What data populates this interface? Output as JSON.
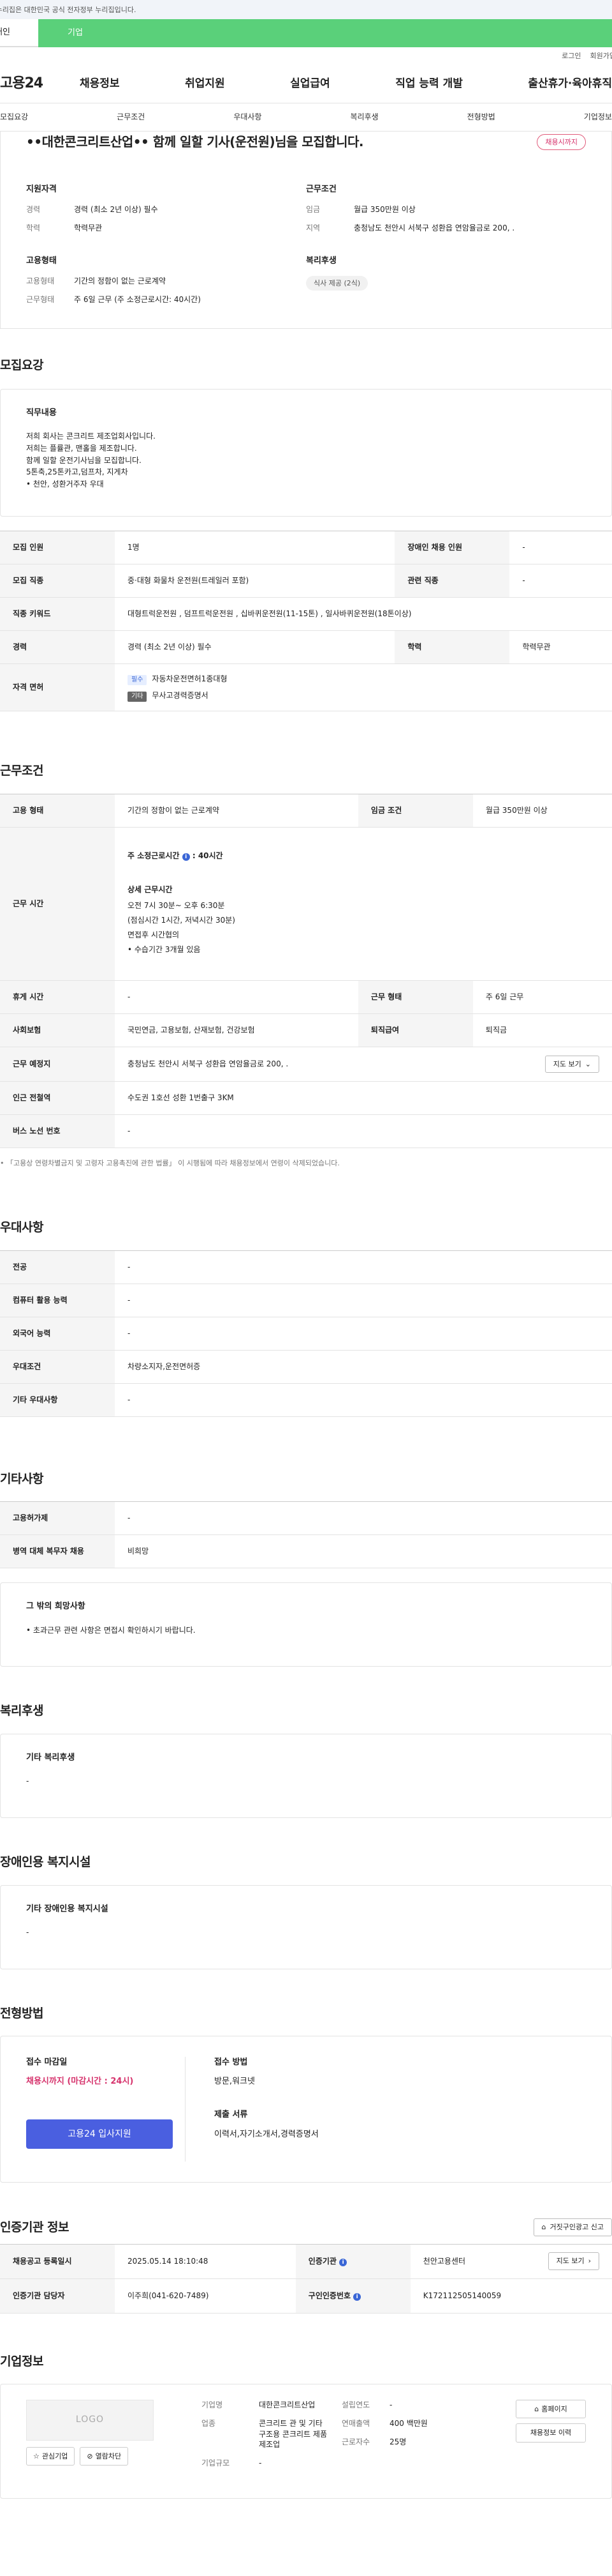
{
  "gov_banner": "이 누리집은 대한민국 공식 전자정부 누리집입니다.",
  "site_tabs": {
    "personal": "개인",
    "company": "기업"
  },
  "util": {
    "login": "로그인",
    "join": "회원가입"
  },
  "gnb": {
    "logo": "고용24",
    "menu": [
      "채용정보",
      "취업지원",
      "실업급여",
      "직업 능력 개발",
      "출산휴가·육아휴직"
    ]
  },
  "subnav": [
    "모집요강",
    "근무조건",
    "우대사항",
    "복리후생",
    "전형방법",
    "기업정보"
  ],
  "summary": {
    "title": "••대한콘크리트산업•• 함께 일할 기사(운전원)님을 모집합니다.",
    "deadline_badge": "채용시까지",
    "qualification": {
      "heading": "지원자격",
      "rows": [
        {
          "k": "경력",
          "v": "경력 (최소 2년 이상) 필수"
        },
        {
          "k": "학력",
          "v": "학력무관"
        }
      ]
    },
    "conditions": {
      "heading": "근무조건",
      "rows": [
        {
          "k": "임금",
          "v": "월급 350만원 이상"
        },
        {
          "k": "지역",
          "v": "충청남도 천안시 서북구 성환읍 연암율금로 200, ."
        }
      ]
    },
    "employment": {
      "heading": "고용형태",
      "rows": [
        {
          "k": "고용형태",
          "v": "기간의 정함이 없는 근로계약"
        },
        {
          "k": "근무형태",
          "v": "주 6일 근무 (주 소정근로시간: 40시간)"
        }
      ]
    },
    "welfare": {
      "heading": "복리후생",
      "pill": "식사 제공 (2식)"
    }
  },
  "recruit": {
    "title": "모집요강",
    "duty_heading": "직무내용",
    "duty_text": "저희 회사는 콘크리트 제조업회사입니다.\n저희는 플률관, 맨홀을 제조합니다.\n함께 일할 운전기사님을 모집합니다.\n5톤축,25톤카고,덤프차, 지게차\n• 천안, 성환거주자 우대",
    "labels": {
      "count": "모집 인원",
      "disabled": "장애인 채용 인원",
      "job": "모집 직종",
      "related": "관련 직종",
      "keywords": "직종 키워드",
      "career": "경력",
      "edu": "학력",
      "license": "자격 면허"
    },
    "count": "1명",
    "disabled": "-",
    "job": "중·대형 화물차 운전원(트레일러 포함)",
    "related": "-",
    "keywords": "대형트럭운전원 , 덤프트럭운전원 , 십바퀴운전원(11-15톤) , 일사바퀴운전원(18톤이상)",
    "career": "경력 (최소 2년 이상) 필수",
    "edu": "학력무관",
    "licenses": [
      {
        "tag": "필수",
        "name": "자동차운전면허1종대형"
      },
      {
        "tag": "기타",
        "name": "무사고경력증명서"
      }
    ]
  },
  "work": {
    "title": "근무조건",
    "labels": {
      "emp_type": "고용 형태",
      "wage": "임금 조건",
      "hours": "근무 시간",
      "holiday": "휴게 시간",
      "work_form": "근무 형태",
      "insurance": "사회보험",
      "retire": "퇴직급여",
      "place": "근무 예정지",
      "subway": "인근 전철역",
      "bus": "버스 노선 번호"
    },
    "emp_type": "기간의 정함이 없는 근로계약",
    "wage": "월급 350만원 이상",
    "hours_title": "주 소정근로시간",
    "hours_value": ": 40시간",
    "hours_detail_title": "상세 근무시간",
    "hours_detail": "오전 7시 30분~ 오후 6:30분\n(점심시간 1시간, 저녁시간 30분)\n면접후 시간협의\n• 수습기간 3개월 있음",
    "holiday": "-",
    "work_form": "주 6일 근무",
    "insurance": "국민연금, 고용보험, 산재보험, 건강보험",
    "retire": "퇴직금",
    "place": "충청남도 천안시 서북구 성환읍 연암율금로 200, .",
    "map_btn": "지도 보기",
    "subway": "수도권 1호선 성환 1번출구 3KM",
    "bus": "-",
    "note": "• 「고용상 연령차별금지 및 고령자 고용촉진에 관한 법률」 이 시행됨에 따라 채용정보에서 연령이 삭제되었습니다."
  },
  "prefer": {
    "title": "우대사항",
    "rows": [
      {
        "k": "전공",
        "v": "-"
      },
      {
        "k": "컴퓨터 활용 능력",
        "v": "-"
      },
      {
        "k": "외국어 능력",
        "v": "-"
      },
      {
        "k": "우대조건",
        "v": "차량소지자,운전면허증"
      },
      {
        "k": "기타 우대사항",
        "v": "-"
      }
    ]
  },
  "other": {
    "title": "기타사항",
    "rows": [
      {
        "k": "고용허가제",
        "v": "-"
      },
      {
        "k": "병역 대체 복무자 채용",
        "v": "비희망"
      }
    ],
    "hope_heading": "그 밖의 희망사항",
    "hope_text": "• 초과근무 관련 사항은 면접시 확인하시기 바랍니다."
  },
  "benefits": {
    "title": "복리후생",
    "heading": "기타 복리후생",
    "text": "-"
  },
  "facility": {
    "title": "장애인용 복지시설",
    "heading": "기타 장애인용 복지시설",
    "text": "-"
  },
  "process": {
    "title": "전형방법",
    "deadline_label": "접수 마감일",
    "deadline_value": "채용시까지 (마감시간 : 24시)",
    "apply_btn": "고용24 입사지원",
    "method_label": "접수 방법",
    "method_value": "방문,워크넷",
    "docs_label": "제출 서류",
    "docs_value": "이력서,자기소개서,경력증명서"
  },
  "agency": {
    "title": "인증기관 정보",
    "report_btn": "거짓구인광고 신고",
    "labels": {
      "reg": "채용공고 등록일시",
      "org": "인증기관",
      "staff": "인증기관 담당자",
      "num": "구인인증번호"
    },
    "reg": "2025.05.14 18:10:48",
    "org": "천안고용센터",
    "map_btn": "지도 보기",
    "staff": "이주희(041-620-7489)",
    "num": "K172112505140059"
  },
  "company": {
    "title": "기업정보",
    "logo_text": "LOGO",
    "interest_btn": "관심기업",
    "block_btn": "열람차단",
    "labels": {
      "name": "기업명",
      "industry": "업종",
      "scale": "기업규모",
      "founded": "설립연도",
      "sales": "연매출액",
      "employees": "근로자수"
    },
    "name": "대한콘크리트산업",
    "industry": "콘크리트 관 및 기타 구조용 콘크리트 제품 제조업",
    "scale": "-",
    "founded": "-",
    "sales": "400 백만원",
    "employees": "25명",
    "home_btn": "홈페이지",
    "list_btn": "채용정보 이력"
  }
}
